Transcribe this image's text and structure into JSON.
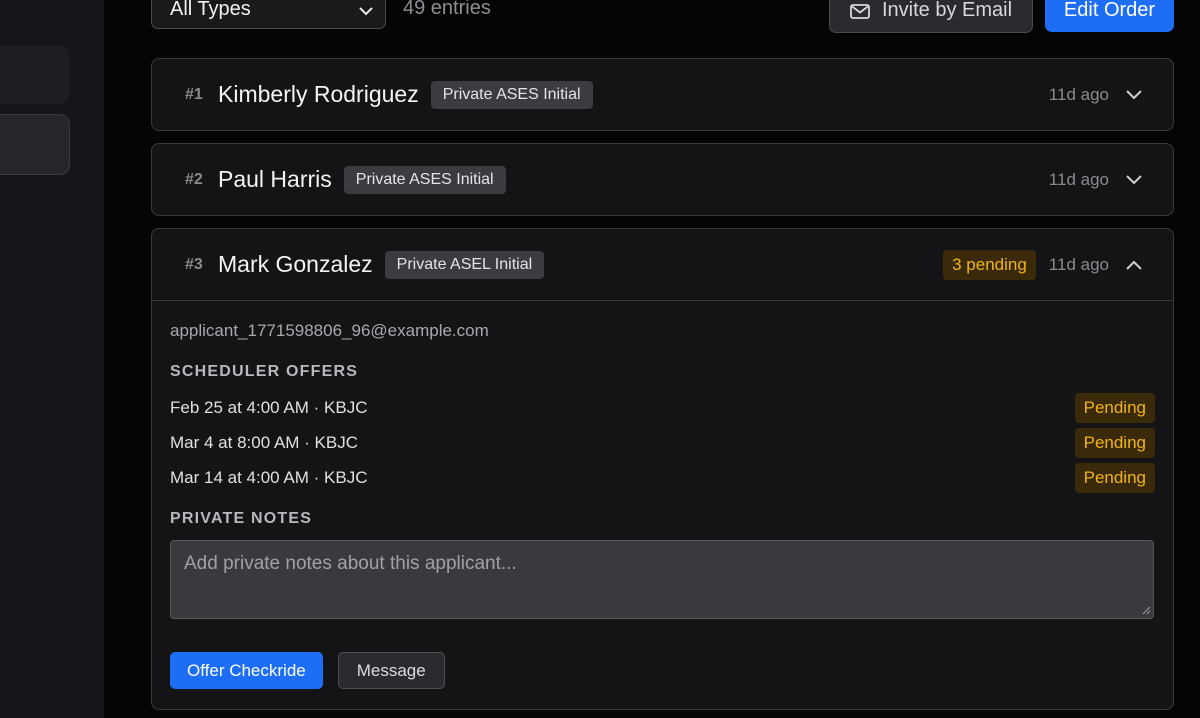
{
  "toolbar": {
    "type_filter": "All Types",
    "entries": "49 entries",
    "invite_label": "Invite by Email",
    "edit_label": "Edit Order"
  },
  "applicants": [
    {
      "num": "#1",
      "name": "Kimberly Rodriguez",
      "tag": "Private ASES Initial",
      "ago": "11d ago"
    },
    {
      "num": "#2",
      "name": "Paul Harris",
      "tag": "Private ASES Initial",
      "ago": "11d ago"
    },
    {
      "num": "#3",
      "name": "Mark Gonzalez",
      "tag": "Private ASEL Initial",
      "pending": "3 pending",
      "ago": "11d ago",
      "email": "applicant_1771598806_96@example.com",
      "offers_title": "SCHEDULER OFFERS",
      "offers": [
        {
          "text": "Feb 25 at 4:00 AM · KBJC",
          "status": "Pending"
        },
        {
          "text": "Mar 4 at 8:00 AM · KBJC",
          "status": "Pending"
        },
        {
          "text": "Mar 14 at 4:00 AM · KBJC",
          "status": "Pending"
        }
      ],
      "notes_title": "PRIVATE NOTES",
      "notes_placeholder": "Add private notes about this applicant...",
      "offer_button": "Offer Checkride",
      "message_button": "Message"
    }
  ],
  "colors": {
    "accent": "#1d6ef5",
    "pending_text": "#f2b318",
    "pending_bg": "#3a2a0a"
  },
  "icons": {
    "select": "chevron-down-icon",
    "invite": "envelope-icon",
    "collapsed": "chevron-down-icon",
    "expanded": "chevron-up-icon"
  }
}
